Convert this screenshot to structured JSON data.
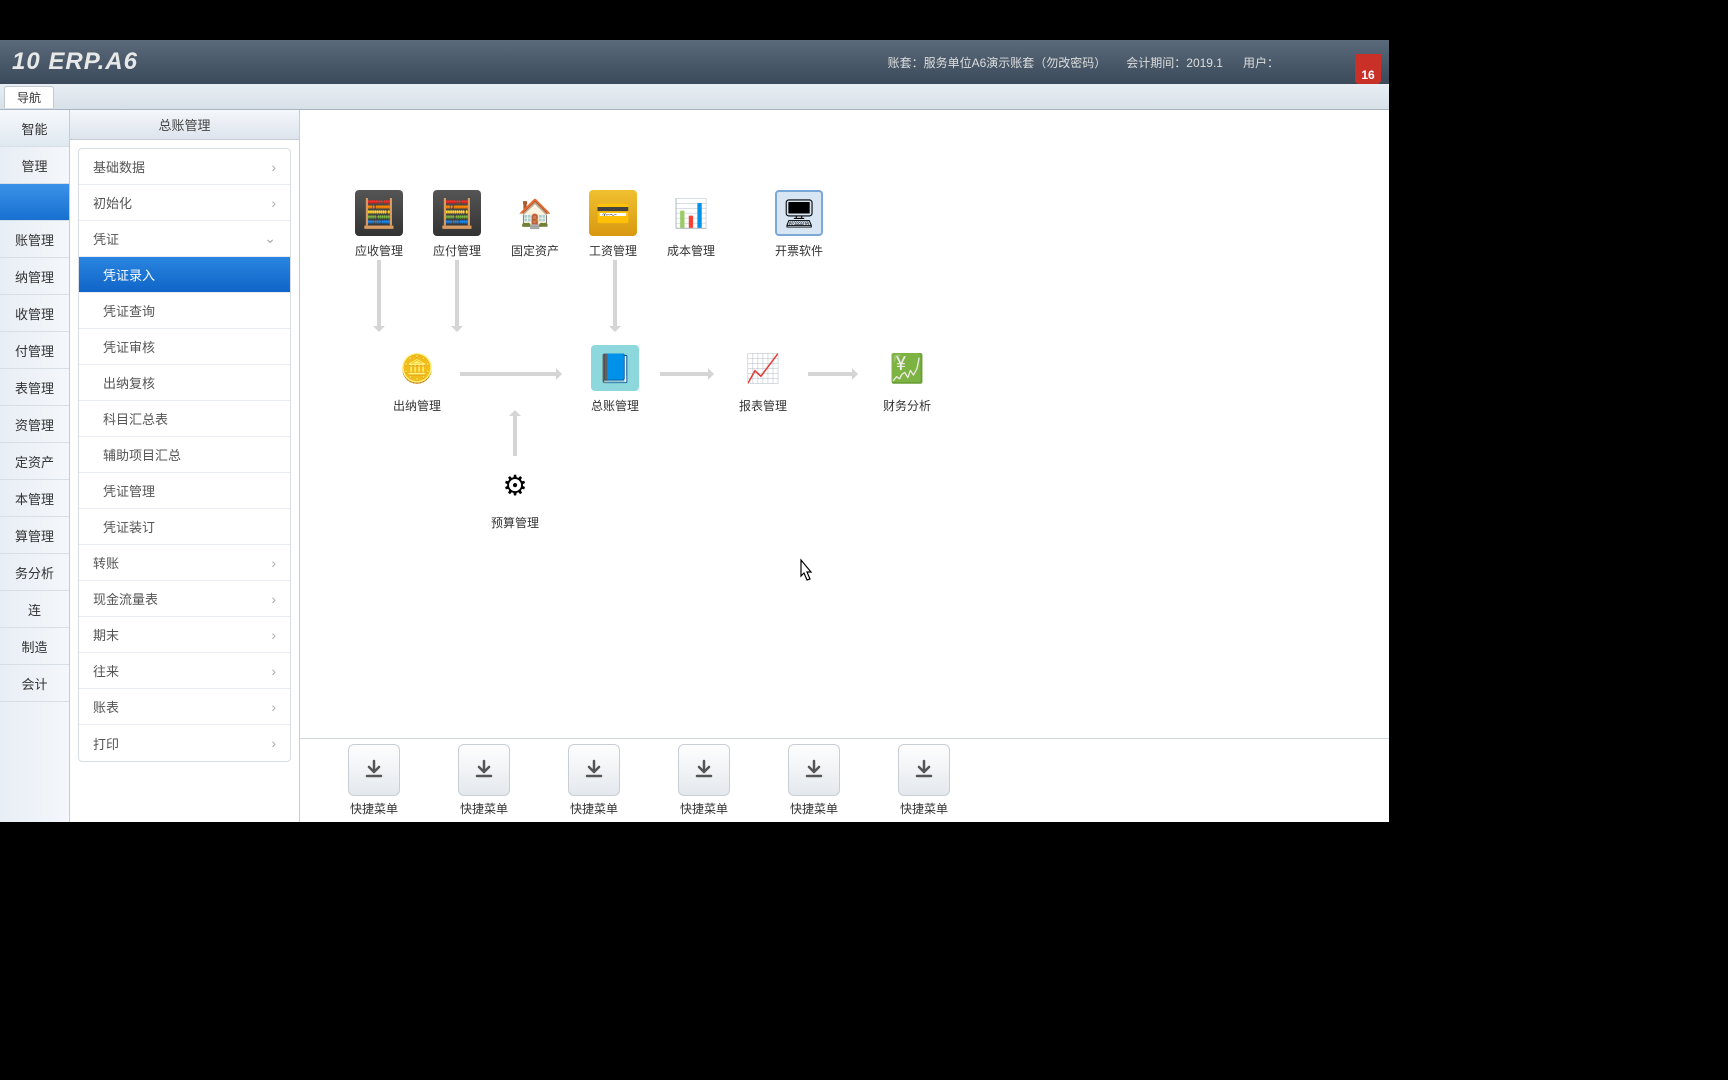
{
  "header": {
    "logo_text": "10 ERP.A6",
    "account_label": "账套：",
    "account_value": "服务单位A6演示账套（勿改密码）",
    "period_label": "会计期间：",
    "period_value": "2019.1",
    "user_label": "用户：",
    "calendar_day": "16"
  },
  "tab": {
    "nav": "导航"
  },
  "leftnav": {
    "items": [
      "智能",
      "管理",
      "",
      "账管理",
      "纳管理",
      "收管理",
      "付管理",
      "表管理",
      "资管理",
      "定资产",
      "本管理",
      "算管理",
      "务分析",
      "连",
      "制造",
      "会计"
    ],
    "active_index": 2
  },
  "sidepanel": {
    "title": "总账管理",
    "menu": [
      {
        "label": "基础数据",
        "type": "parent"
      },
      {
        "label": "初始化",
        "type": "parent"
      },
      {
        "label": "凭证",
        "type": "parent",
        "expanded": true,
        "children": [
          {
            "label": "凭证录入",
            "active": true
          },
          {
            "label": "凭证查询"
          },
          {
            "label": "凭证审核"
          },
          {
            "label": "出纳复核"
          },
          {
            "label": "科目汇总表"
          },
          {
            "label": "辅助项目汇总"
          },
          {
            "label": "凭证管理"
          },
          {
            "label": "凭证装订"
          }
        ]
      },
      {
        "label": "转账",
        "type": "parent"
      },
      {
        "label": "现金流量表",
        "type": "parent"
      },
      {
        "label": "期末",
        "type": "parent"
      },
      {
        "label": "往来",
        "type": "parent"
      },
      {
        "label": "账表",
        "type": "parent"
      },
      {
        "label": "打印",
        "type": "parent"
      }
    ]
  },
  "flow": {
    "row1": [
      {
        "label": "应收管理",
        "icon": "calc"
      },
      {
        "label": "应付管理",
        "icon": "calc"
      },
      {
        "label": "固定资产",
        "icon": "house"
      },
      {
        "label": "工资管理",
        "icon": "card"
      },
      {
        "label": "成本管理",
        "icon": "chart"
      },
      {
        "label": "开票软件",
        "icon": "screen"
      }
    ],
    "row2": [
      {
        "label": "出纳管理",
        "icon": "coins"
      },
      {
        "label": "总账管理",
        "icon": "book"
      },
      {
        "label": "报表管理",
        "icon": "report"
      },
      {
        "label": "财务分析",
        "icon": "analysis"
      }
    ],
    "row3": [
      {
        "label": "预算管理",
        "icon": "gear"
      }
    ]
  },
  "quickmenu": {
    "label": "快捷菜单",
    "count": 6
  }
}
